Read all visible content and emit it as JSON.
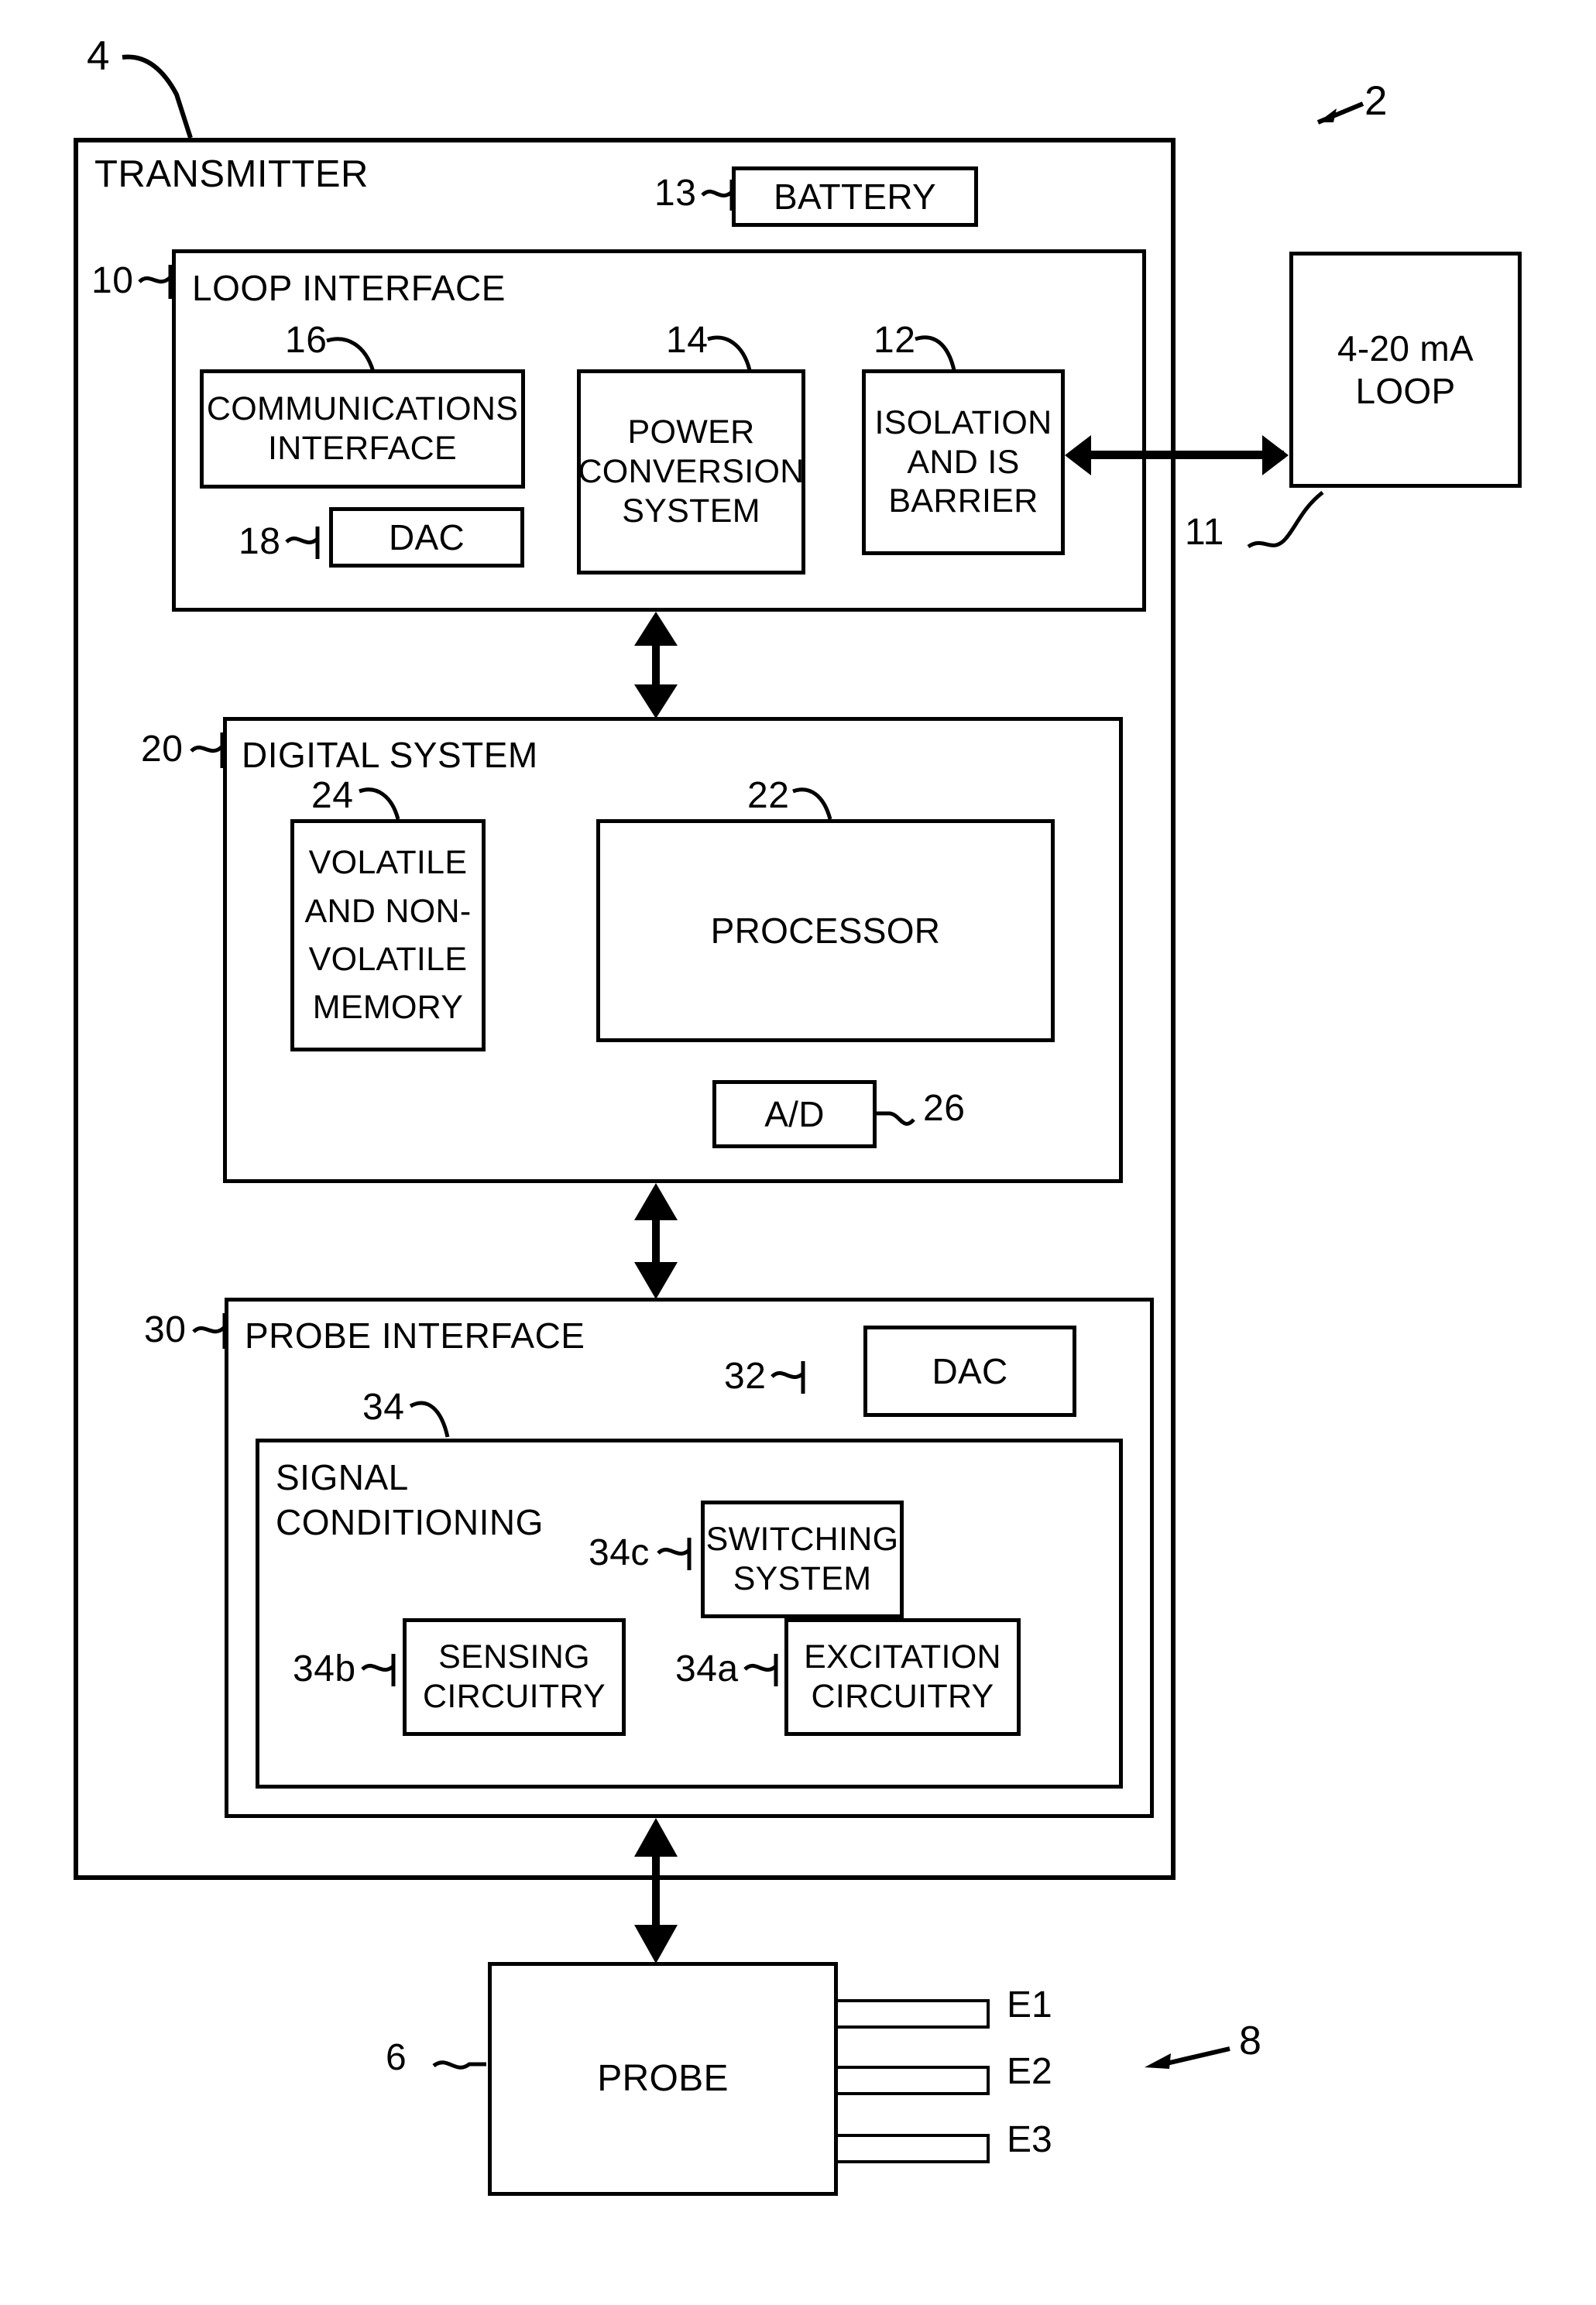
{
  "figure": {
    "type": "patent-block-diagram",
    "system_ref": "2",
    "transmitter": {
      "ref": "4",
      "title": "TRANSMITTER",
      "battery": {
        "ref": "13",
        "label": "BATTERY"
      },
      "loop_interface": {
        "ref": "10",
        "title": "LOOP INTERFACE",
        "blocks": [
          {
            "ref": "16",
            "label": "COMMUNICATIONS\nINTERFACE",
            "line1": "COMMUNICATIONS",
            "line2": "INTERFACE"
          },
          {
            "ref": "18",
            "label": "DAC"
          },
          {
            "ref": "14",
            "label": "POWER CONVERSION SYSTEM",
            "line1": "POWER",
            "line2": "CONVERSION",
            "line3": "SYSTEM"
          },
          {
            "ref": "12",
            "label": "ISOLATION AND IS BARRIER",
            "line1": "ISOLATION",
            "line2": "AND IS",
            "line3": "BARRIER"
          }
        ]
      },
      "digital_system": {
        "ref": "20",
        "title": "DIGITAL SYSTEM",
        "blocks": [
          {
            "ref": "24",
            "label": "VOLATILE AND NON-VOLATILE MEMORY",
            "line1": "VOLATILE",
            "line2": "AND NON-",
            "line3": "VOLATILE",
            "line4": "MEMORY"
          },
          {
            "ref": "22",
            "label": "PROCESSOR"
          },
          {
            "ref": "26",
            "label": "A/D"
          }
        ]
      },
      "probe_interface": {
        "ref": "30",
        "title": "PROBE INTERFACE",
        "dac": {
          "ref": "32",
          "label": "DAC"
        },
        "signal_conditioning": {
          "ref": "34",
          "title_line1": "SIGNAL",
          "title_line2": "CONDITIONING",
          "blocks": [
            {
              "ref": "34c",
              "label": "SWITCHING SYSTEM",
              "line1": "SWITCHING",
              "line2": "SYSTEM"
            },
            {
              "ref": "34b",
              "label": "SENSING CIRCUITRY",
              "line1": "SENSING",
              "line2": "CIRCUITRY"
            },
            {
              "ref": "34a",
              "label": "EXCITATION CIRCUITRY",
              "line1": "EXCITATION",
              "line2": "CIRCUITRY"
            }
          ]
        }
      }
    },
    "loop": {
      "ref": "11",
      "line1": "4-20 mA",
      "line2": "LOOP"
    },
    "probe_assembly": {
      "ref": "6",
      "label": "PROBE",
      "group_ref": "8",
      "electrodes": [
        "E1",
        "E2",
        "E3"
      ]
    }
  }
}
